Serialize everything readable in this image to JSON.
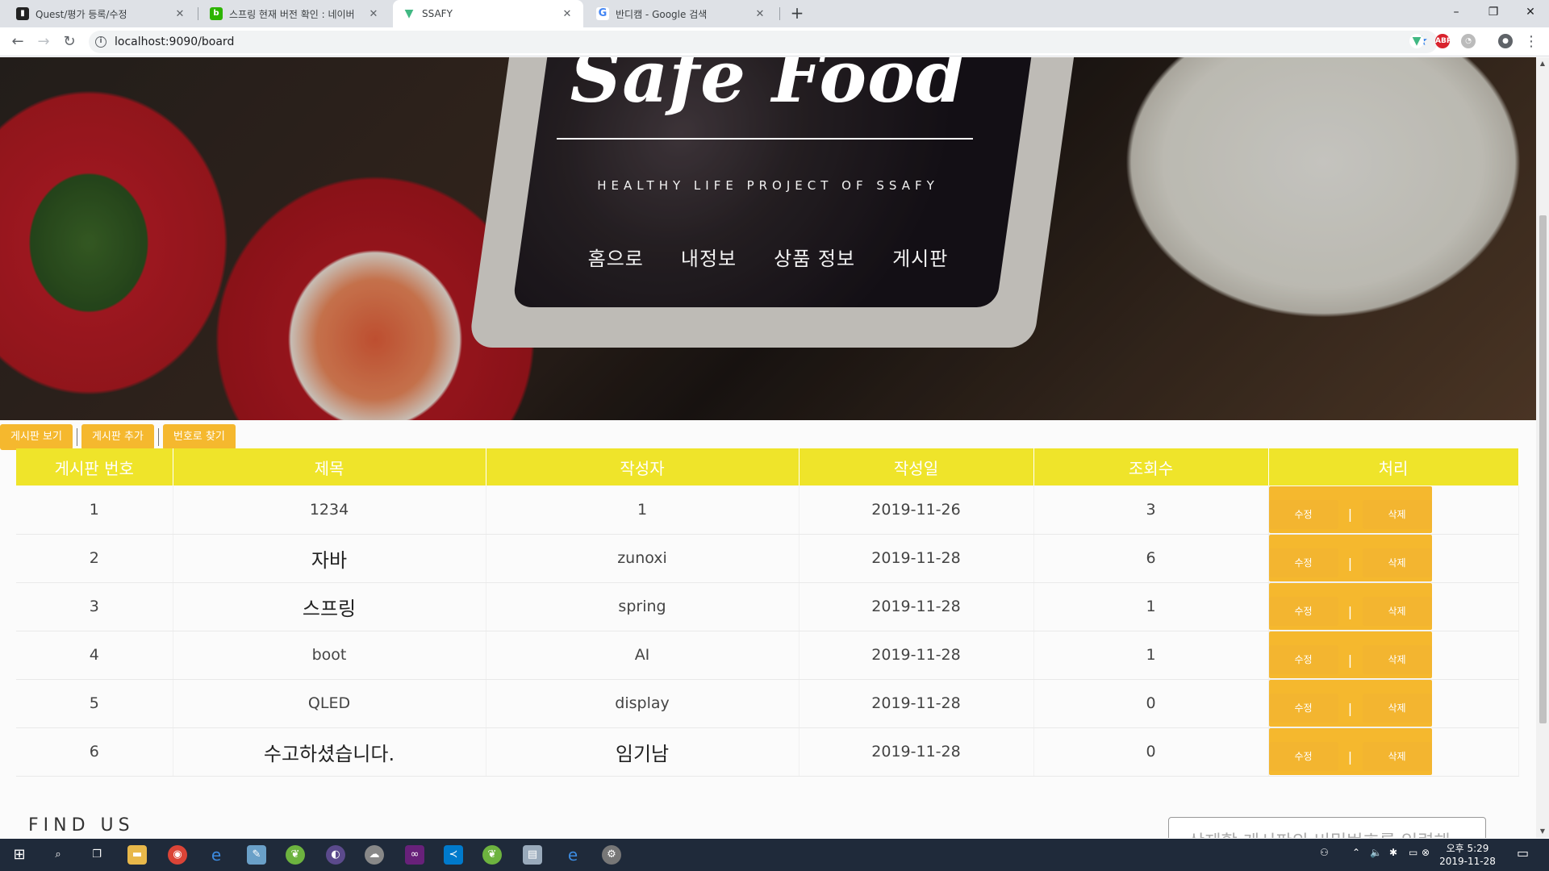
{
  "browser": {
    "tabs": [
      {
        "title": "Quest/평가 등록/수정",
        "favicon": "document-icon"
      },
      {
        "title": "스프링 현재 버전 확인 : 네이버",
        "favicon": "naver-blog-icon"
      },
      {
        "title": "SSAFY",
        "favicon": "vue-icon"
      },
      {
        "title": "반디캠 - Google 검색",
        "favicon": "google-icon"
      }
    ],
    "url": "localhost:9090/board"
  },
  "hero": {
    "title": "Safe Food",
    "subtitle": "HEALTHY LIFE PROJECT OF SSAFY",
    "nav": [
      "홈으로",
      "내정보",
      "상품 정보",
      "게시판"
    ]
  },
  "actions": [
    "게시판 보기",
    "게시판 추가",
    "번호로 찾기"
  ],
  "table": {
    "headers": [
      "게시판 번호",
      "제목",
      "작성자",
      "작성일",
      "조회수",
      "처리"
    ],
    "rows": [
      {
        "no": "1",
        "title": "1234",
        "author": "1",
        "date": "2019-11-26",
        "views": "3"
      },
      {
        "no": "2",
        "title": "자바",
        "author": "zunoxi",
        "date": "2019-11-28",
        "views": "6"
      },
      {
        "no": "3",
        "title": "스프링",
        "author": "spring",
        "date": "2019-11-28",
        "views": "1"
      },
      {
        "no": "4",
        "title": "boot",
        "author": "AI",
        "date": "2019-11-28",
        "views": "1"
      },
      {
        "no": "5",
        "title": "QLED",
        "author": "display",
        "date": "2019-11-28",
        "views": "0"
      },
      {
        "no": "6",
        "title": "수고하셨습니다.",
        "author": "임기남",
        "date": "2019-11-28",
        "views": "0"
      }
    ],
    "edit_label": "수정",
    "delete_label": "삭제",
    "separator": "|"
  },
  "footer": {
    "find_us": "FIND US",
    "password_placeholder": "삭제할 게시판의 비밀번호를 입력해"
  },
  "taskbar": {
    "time": "오후 5:29",
    "date": "2019-11-28"
  },
  "colors": {
    "header_yellow": "#efe42a",
    "button_orange": "#f5b82e"
  }
}
